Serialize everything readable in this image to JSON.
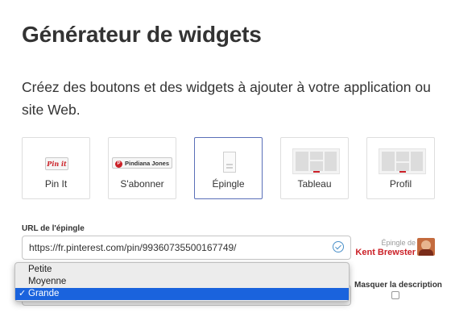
{
  "page": {
    "title": "Générateur de widgets",
    "subtitle": "Créez des boutons et des widgets à ajouter à votre application ou site Web."
  },
  "widget_types": [
    {
      "label": "Pin It",
      "preview": "Pin it"
    },
    {
      "label": "S'abonner",
      "preview": "Pindiana Jones"
    },
    {
      "label": "Épingle"
    },
    {
      "label": "Tableau"
    },
    {
      "label": "Profil"
    }
  ],
  "selected_widget": "Épingle",
  "url_field": {
    "label": "URL de l'épingle",
    "value": "https://fr.pinterest.com/pin/99360735500167749/"
  },
  "pinned_by": {
    "prefix": "Épingle de",
    "name": "Kent Brewster"
  },
  "size_dropdown": {
    "options": [
      "Petite",
      "Moyenne",
      "Grande"
    ],
    "selected": "Grande",
    "check_mark": "✓"
  },
  "hide_description": {
    "label": "Masquer la description",
    "checked": false
  },
  "colors": {
    "pinterest_red": "#cb2027",
    "selection_blue": "#1a63dd",
    "selected_border": "#5a6fb8"
  }
}
